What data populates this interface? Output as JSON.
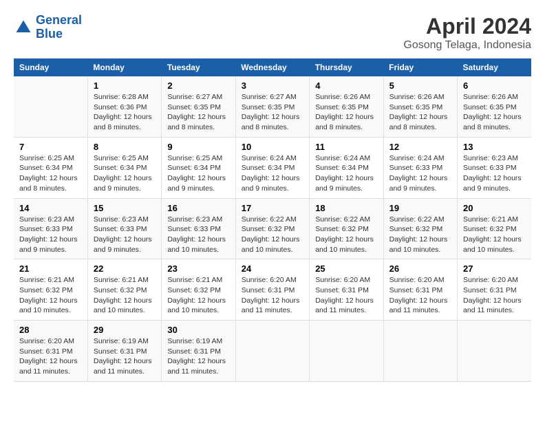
{
  "logo": {
    "line1": "General",
    "line2": "Blue"
  },
  "title": "April 2024",
  "subtitle": "Gosong Telaga, Indonesia",
  "headers": [
    "Sunday",
    "Monday",
    "Tuesday",
    "Wednesday",
    "Thursday",
    "Friday",
    "Saturday"
  ],
  "weeks": [
    [
      {
        "day": "",
        "sunrise": "",
        "sunset": "",
        "daylight": ""
      },
      {
        "day": "1",
        "sunrise": "Sunrise: 6:28 AM",
        "sunset": "Sunset: 6:36 PM",
        "daylight": "Daylight: 12 hours and 8 minutes."
      },
      {
        "day": "2",
        "sunrise": "Sunrise: 6:27 AM",
        "sunset": "Sunset: 6:35 PM",
        "daylight": "Daylight: 12 hours and 8 minutes."
      },
      {
        "day": "3",
        "sunrise": "Sunrise: 6:27 AM",
        "sunset": "Sunset: 6:35 PM",
        "daylight": "Daylight: 12 hours and 8 minutes."
      },
      {
        "day": "4",
        "sunrise": "Sunrise: 6:26 AM",
        "sunset": "Sunset: 6:35 PM",
        "daylight": "Daylight: 12 hours and 8 minutes."
      },
      {
        "day": "5",
        "sunrise": "Sunrise: 6:26 AM",
        "sunset": "Sunset: 6:35 PM",
        "daylight": "Daylight: 12 hours and 8 minutes."
      },
      {
        "day": "6",
        "sunrise": "Sunrise: 6:26 AM",
        "sunset": "Sunset: 6:35 PM",
        "daylight": "Daylight: 12 hours and 8 minutes."
      }
    ],
    [
      {
        "day": "7",
        "sunrise": "Sunrise: 6:25 AM",
        "sunset": "Sunset: 6:34 PM",
        "daylight": "Daylight: 12 hours and 8 minutes."
      },
      {
        "day": "8",
        "sunrise": "Sunrise: 6:25 AM",
        "sunset": "Sunset: 6:34 PM",
        "daylight": "Daylight: 12 hours and 9 minutes."
      },
      {
        "day": "9",
        "sunrise": "Sunrise: 6:25 AM",
        "sunset": "Sunset: 6:34 PM",
        "daylight": "Daylight: 12 hours and 9 minutes."
      },
      {
        "day": "10",
        "sunrise": "Sunrise: 6:24 AM",
        "sunset": "Sunset: 6:34 PM",
        "daylight": "Daylight: 12 hours and 9 minutes."
      },
      {
        "day": "11",
        "sunrise": "Sunrise: 6:24 AM",
        "sunset": "Sunset: 6:34 PM",
        "daylight": "Daylight: 12 hours and 9 minutes."
      },
      {
        "day": "12",
        "sunrise": "Sunrise: 6:24 AM",
        "sunset": "Sunset: 6:33 PM",
        "daylight": "Daylight: 12 hours and 9 minutes."
      },
      {
        "day": "13",
        "sunrise": "Sunrise: 6:23 AM",
        "sunset": "Sunset: 6:33 PM",
        "daylight": "Daylight: 12 hours and 9 minutes."
      }
    ],
    [
      {
        "day": "14",
        "sunrise": "Sunrise: 6:23 AM",
        "sunset": "Sunset: 6:33 PM",
        "daylight": "Daylight: 12 hours and 9 minutes."
      },
      {
        "day": "15",
        "sunrise": "Sunrise: 6:23 AM",
        "sunset": "Sunset: 6:33 PM",
        "daylight": "Daylight: 12 hours and 9 minutes."
      },
      {
        "day": "16",
        "sunrise": "Sunrise: 6:23 AM",
        "sunset": "Sunset: 6:33 PM",
        "daylight": "Daylight: 12 hours and 10 minutes."
      },
      {
        "day": "17",
        "sunrise": "Sunrise: 6:22 AM",
        "sunset": "Sunset: 6:32 PM",
        "daylight": "Daylight: 12 hours and 10 minutes."
      },
      {
        "day": "18",
        "sunrise": "Sunrise: 6:22 AM",
        "sunset": "Sunset: 6:32 PM",
        "daylight": "Daylight: 12 hours and 10 minutes."
      },
      {
        "day": "19",
        "sunrise": "Sunrise: 6:22 AM",
        "sunset": "Sunset: 6:32 PM",
        "daylight": "Daylight: 12 hours and 10 minutes."
      },
      {
        "day": "20",
        "sunrise": "Sunrise: 6:21 AM",
        "sunset": "Sunset: 6:32 PM",
        "daylight": "Daylight: 12 hours and 10 minutes."
      }
    ],
    [
      {
        "day": "21",
        "sunrise": "Sunrise: 6:21 AM",
        "sunset": "Sunset: 6:32 PM",
        "daylight": "Daylight: 12 hours and 10 minutes."
      },
      {
        "day": "22",
        "sunrise": "Sunrise: 6:21 AM",
        "sunset": "Sunset: 6:32 PM",
        "daylight": "Daylight: 12 hours and 10 minutes."
      },
      {
        "day": "23",
        "sunrise": "Sunrise: 6:21 AM",
        "sunset": "Sunset: 6:32 PM",
        "daylight": "Daylight: 12 hours and 10 minutes."
      },
      {
        "day": "24",
        "sunrise": "Sunrise: 6:20 AM",
        "sunset": "Sunset: 6:31 PM",
        "daylight": "Daylight: 12 hours and 11 minutes."
      },
      {
        "day": "25",
        "sunrise": "Sunrise: 6:20 AM",
        "sunset": "Sunset: 6:31 PM",
        "daylight": "Daylight: 12 hours and 11 minutes."
      },
      {
        "day": "26",
        "sunrise": "Sunrise: 6:20 AM",
        "sunset": "Sunset: 6:31 PM",
        "daylight": "Daylight: 12 hours and 11 minutes."
      },
      {
        "day": "27",
        "sunrise": "Sunrise: 6:20 AM",
        "sunset": "Sunset: 6:31 PM",
        "daylight": "Daylight: 12 hours and 11 minutes."
      }
    ],
    [
      {
        "day": "28",
        "sunrise": "Sunrise: 6:20 AM",
        "sunset": "Sunset: 6:31 PM",
        "daylight": "Daylight: 12 hours and 11 minutes."
      },
      {
        "day": "29",
        "sunrise": "Sunrise: 6:19 AM",
        "sunset": "Sunset: 6:31 PM",
        "daylight": "Daylight: 12 hours and 11 minutes."
      },
      {
        "day": "30",
        "sunrise": "Sunrise: 6:19 AM",
        "sunset": "Sunset: 6:31 PM",
        "daylight": "Daylight: 12 hours and 11 minutes."
      },
      {
        "day": "",
        "sunrise": "",
        "sunset": "",
        "daylight": ""
      },
      {
        "day": "",
        "sunrise": "",
        "sunset": "",
        "daylight": ""
      },
      {
        "day": "",
        "sunrise": "",
        "sunset": "",
        "daylight": ""
      },
      {
        "day": "",
        "sunrise": "",
        "sunset": "",
        "daylight": ""
      }
    ]
  ]
}
